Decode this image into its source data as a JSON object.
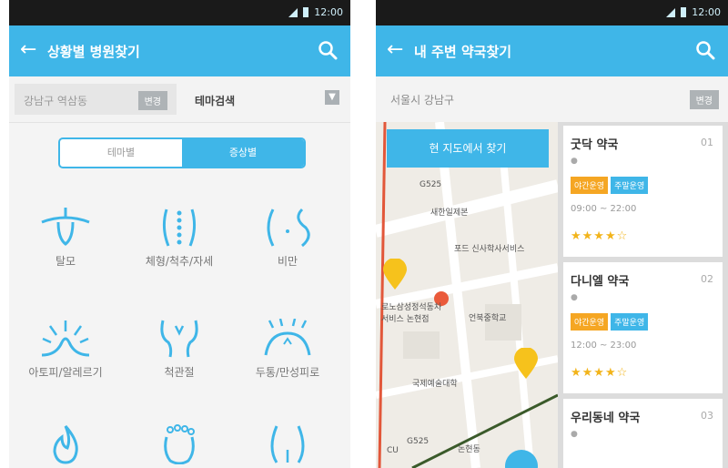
{
  "left": {
    "status_time": "12:00",
    "appbar": {
      "title": "상황별 병원찾기"
    },
    "filter": {
      "location": "강남구 역삼동",
      "location_button": "변경",
      "theme_search": "테마검색"
    },
    "segment": {
      "tab_theme": "테마별",
      "tab_symptom": "증상별"
    },
    "categories": [
      {
        "label": "탈모"
      },
      {
        "label": "체형/척추/자세"
      },
      {
        "label": "비만"
      },
      {
        "label": "아토피/알레르기"
      },
      {
        "label": "척관절"
      },
      {
        "label": "두통/만성피로"
      }
    ]
  },
  "right": {
    "status_time": "12:00",
    "appbar": {
      "title": "내 주변 약국찾기"
    },
    "address": {
      "text": "서울시 강남구",
      "button": "변경"
    },
    "map": {
      "button": "현 지도에서 찾기",
      "labels": [
        "G525",
        "새한일제본",
        "포드 신사학사서비스",
        "로노삼성정석동차 서비스 논현점",
        "언북중학교",
        "국제예술대학",
        "논현동",
        "G525",
        "CU"
      ]
    },
    "pharmacies": [
      {
        "name": "굿닥 약국",
        "number": "01",
        "tag1": "야간운영",
        "tag2": "주말운영",
        "hours": "09:00 ~ 22:00",
        "stars": "★★★★☆"
      },
      {
        "name": "다니엘 약국",
        "number": "02",
        "tag1": "야간운영",
        "tag2": "주말운영",
        "hours": "12:00 ~ 23:00",
        "stars": "★★★★☆"
      },
      {
        "name": "우리동네 약국",
        "number": "03"
      }
    ]
  },
  "colors": {
    "accent": "#3fb6e8",
    "tag_orange": "#f5a623",
    "star": "#f2b41b",
    "pin_yellow": "#f6c21c",
    "pin_red": "#ea5a3a"
  }
}
